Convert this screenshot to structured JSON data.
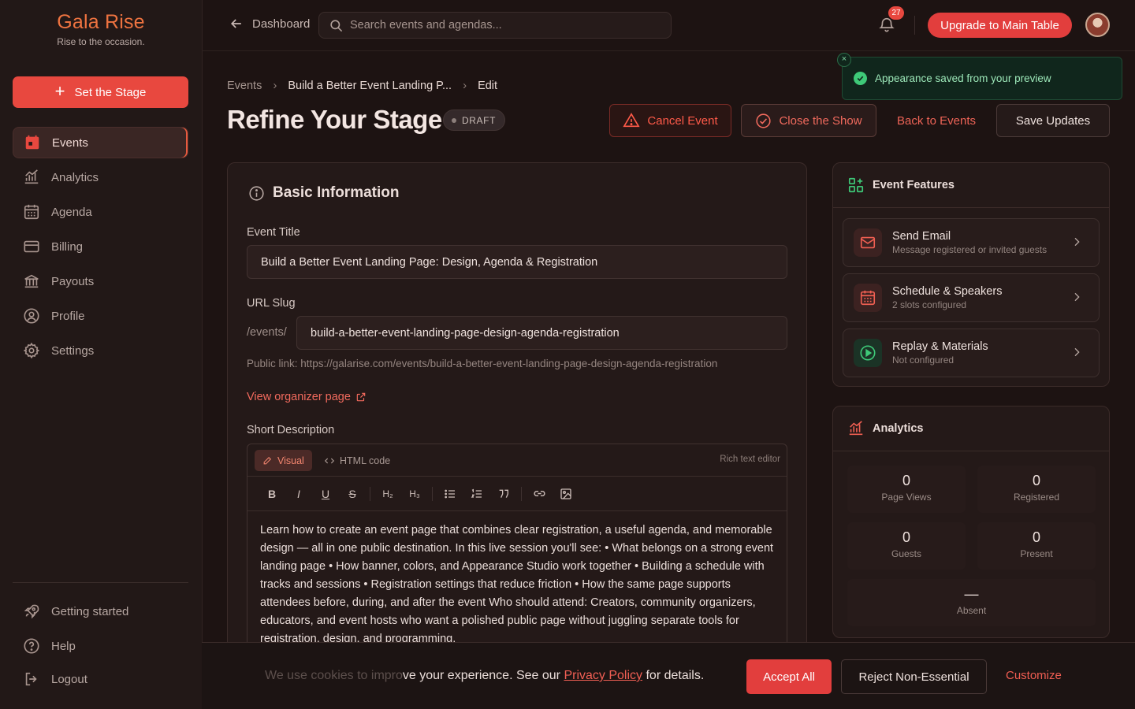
{
  "brand": {
    "name": "Gala Rise",
    "tagline": "Rise to the occasion.",
    "accent": "#e8483f",
    "logo_color": "#ee7340"
  },
  "sidebar": {
    "cta_label": "Set the Stage",
    "items": [
      {
        "label": "Events",
        "icon": "calendar-icon",
        "active": true
      },
      {
        "label": "Analytics",
        "icon": "analytics-icon"
      },
      {
        "label": "Agenda",
        "icon": "agenda-icon"
      },
      {
        "label": "Billing",
        "icon": "credit-card-icon"
      },
      {
        "label": "Payouts",
        "icon": "bank-icon"
      },
      {
        "label": "Profile",
        "icon": "user-circle-icon"
      },
      {
        "label": "Settings",
        "icon": "gear-icon"
      }
    ],
    "bottom_items": [
      {
        "label": "Getting started",
        "icon": "rocket-icon"
      },
      {
        "label": "Help",
        "icon": "help-icon"
      },
      {
        "label": "Logout",
        "icon": "logout-icon"
      }
    ]
  },
  "topbar": {
    "back_label": "Dashboard",
    "search_placeholder": "Search events and agendas...",
    "notification_count": "27",
    "upgrade_label": "Upgrade to Main Table"
  },
  "toast": {
    "message": "Appearance saved from your preview",
    "close_glyph": "×"
  },
  "breadcrumb": [
    "Events",
    "Build a Better Event Landing P...",
    "Edit"
  ],
  "header": {
    "title": "Refine Your Stage",
    "status": "DRAFT",
    "cancel_label": "Cancel Event",
    "close_label": "Close the Show",
    "back_label": "Back to Events",
    "save_label": "Save Updates"
  },
  "basic_info": {
    "title": "Basic Information",
    "event_title_label": "Event Title",
    "event_title_value": "Build a Better Event Landing Page: Design, Agenda & Registration",
    "slug_label": "URL Slug",
    "slug_prefix": "/events/",
    "slug_value": "build-a-better-event-landing-page-design-agenda-registration",
    "public_link": "Public link: https://galarise.com/events/build-a-better-event-landing-page-design-agenda-registration",
    "organizer_link": "View organizer page",
    "description_label": "Short Description",
    "editor": {
      "tab_visual": "Visual",
      "tab_html": "HTML code",
      "meta": "Rich text editor",
      "tools": [
        "B",
        "I",
        "U",
        "S",
        "H₂",
        "H₃"
      ],
      "body": "Learn how to create an event page that combines clear registration, a useful agenda, and memorable design — all in one public destination. In this live session you'll see: • What belongs on a strong event landing page • How banner, colors, and Appearance Studio work together • Building a schedule with tracks and sessions • Registration settings that reduce friction • How the same page supports attendees before, during, and after the event Who should attend: Creators, community organizers, educators, and event hosts who want a polished public page without juggling separate tools for registration, design, and programming."
    }
  },
  "features": {
    "title": "Event Features",
    "items": [
      {
        "title": "Send Email",
        "subtitle": "Message registered or invited guests",
        "icon": "mail-icon"
      },
      {
        "title": "Schedule & Speakers",
        "subtitle": "2 slots configured",
        "icon": "calendar-grid-icon"
      },
      {
        "title": "Replay & Materials",
        "subtitle": "Not configured",
        "icon": "play-circle-icon"
      }
    ]
  },
  "analytics": {
    "title": "Analytics",
    "stats": [
      {
        "value": "0",
        "label": "Page Views"
      },
      {
        "value": "0",
        "label": "Registered"
      },
      {
        "value": "0",
        "label": "Guests"
      },
      {
        "value": "0",
        "label": "Present"
      },
      {
        "value": "—",
        "label": "Absent"
      }
    ]
  },
  "cookie": {
    "text_faded": "We use cookies to impro",
    "text_main": "ve your experience. See our ",
    "link": "Privacy Policy",
    "text_end": " for details.",
    "accept": "Accept All",
    "reject": "Reject Non-Essential",
    "customize": "Customize"
  }
}
